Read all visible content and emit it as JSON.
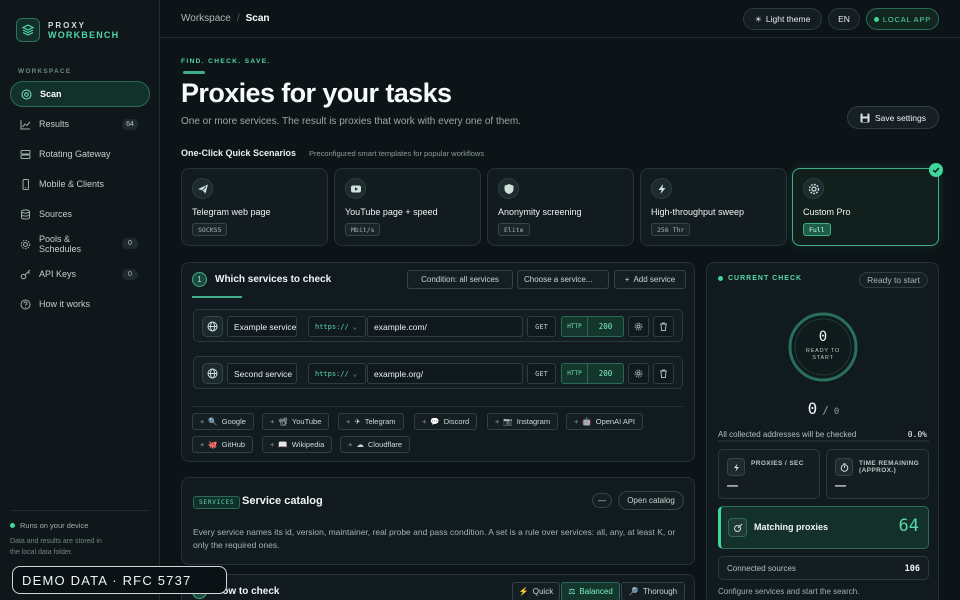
{
  "brand": {
    "line1": "PROXY",
    "line2": "WORKBENCH"
  },
  "sidebar": {
    "section": "WORKSPACE",
    "items": [
      {
        "label": "Scan",
        "icon": "target-icon",
        "badge": ""
      },
      {
        "label": "Results",
        "icon": "chart-icon",
        "badge": "64"
      },
      {
        "label": "Rotating Gateway",
        "icon": "server-icon",
        "badge": ""
      },
      {
        "label": "Mobile & Clients",
        "icon": "phone-icon",
        "badge": ""
      },
      {
        "label": "Sources",
        "icon": "database-icon",
        "badge": ""
      },
      {
        "label": "Pools & Schedules",
        "icon": "gear-icon",
        "badge": "0"
      },
      {
        "label": "API Keys",
        "icon": "key-icon",
        "badge": "0"
      },
      {
        "label": "How it works",
        "icon": "help-icon",
        "badge": ""
      }
    ],
    "footer_status": "Runs on your device",
    "footer_note": "Data and results are stored in the local data folder."
  },
  "topbar": {
    "crumb_root": "Workspace",
    "crumb_sep": "/",
    "crumb_current": "Scan",
    "theme_label": "Light theme",
    "lang_label": "EN",
    "local_label": "LOCAL APP"
  },
  "hero": {
    "kicker": "FIND. CHECK. SAVE.",
    "title": "Proxies for your tasks",
    "subtitle": "One or more services. The result is proxies that work with every one of them.",
    "save_label": "Save settings"
  },
  "quick": {
    "title": "One-Click Quick Scenarios",
    "subtitle": "Preconfigured smart templates for popular workflows",
    "cards": [
      {
        "name": "Telegram web page",
        "tag": "SOCKS5",
        "icon": "telegram-icon"
      },
      {
        "name": "YouTube page + speed",
        "tag": "Mbit/s",
        "icon": "youtube-icon"
      },
      {
        "name": "Anonymity screening",
        "tag": "Elite",
        "icon": "shield-icon"
      },
      {
        "name": "High-throughput sweep",
        "tag": "256 Thr",
        "icon": "bolt-icon"
      },
      {
        "name": "Custom Pro",
        "tag": "Full",
        "icon": "settings-icon",
        "selected": true
      }
    ]
  },
  "services": {
    "step": "1",
    "title": "Which services to check",
    "condition_label": "Condition: all services",
    "choose_label": "Choose a service...",
    "add_label": "Add service",
    "rows": [
      {
        "name": "Example service",
        "scheme": "https://",
        "url": "example.com/",
        "method": "GET",
        "status_key": "HTTP",
        "status_val": "200"
      },
      {
        "name": "Second service",
        "scheme": "https://",
        "url": "example.org/",
        "method": "GET",
        "status_key": "HTTP",
        "status_val": "200"
      }
    ],
    "presets": [
      "Google",
      "YouTube",
      "Telegram",
      "Discord",
      "Instagram",
      "OpenAI API",
      "GitHub",
      "Wikipedia",
      "Cloudflare"
    ]
  },
  "catalog": {
    "tag": "SERVICES",
    "title": "Service catalog",
    "collapse_label": "—",
    "open_label": "Open catalog",
    "text": "Every service names its id, version, maintainer, real probe and pass condition. A set is a rule over services: all, any, at least K, or only the required ones."
  },
  "howto": {
    "title": "How to check",
    "modes": [
      "Quick",
      "Balanced",
      "Thorough"
    ]
  },
  "current": {
    "heading": "CURRENT CHECK",
    "status": "Ready to start",
    "gauge_value": "0",
    "gauge_label": "READY TO START",
    "progress_done": "0",
    "progress_sep": "/",
    "progress_total": "0",
    "all_checked_label": "All collected addresses will be checked",
    "all_checked_value": "0.0%",
    "proxies_label": "PROXIES / SEC",
    "proxies_value": "—",
    "time_label": "TIME REMAINING (APPROX.)",
    "time_value": "—",
    "matching_label": "Matching proxies",
    "matching_value": "64",
    "sources_label": "Connected sources",
    "sources_value": "106",
    "hint": "Configure services and start the search."
  },
  "watermark": "DEMO DATA · RFC 5737",
  "colors": {
    "accent": "#3fd69a",
    "background": "#0d1418",
    "panel": "#111b1f"
  }
}
